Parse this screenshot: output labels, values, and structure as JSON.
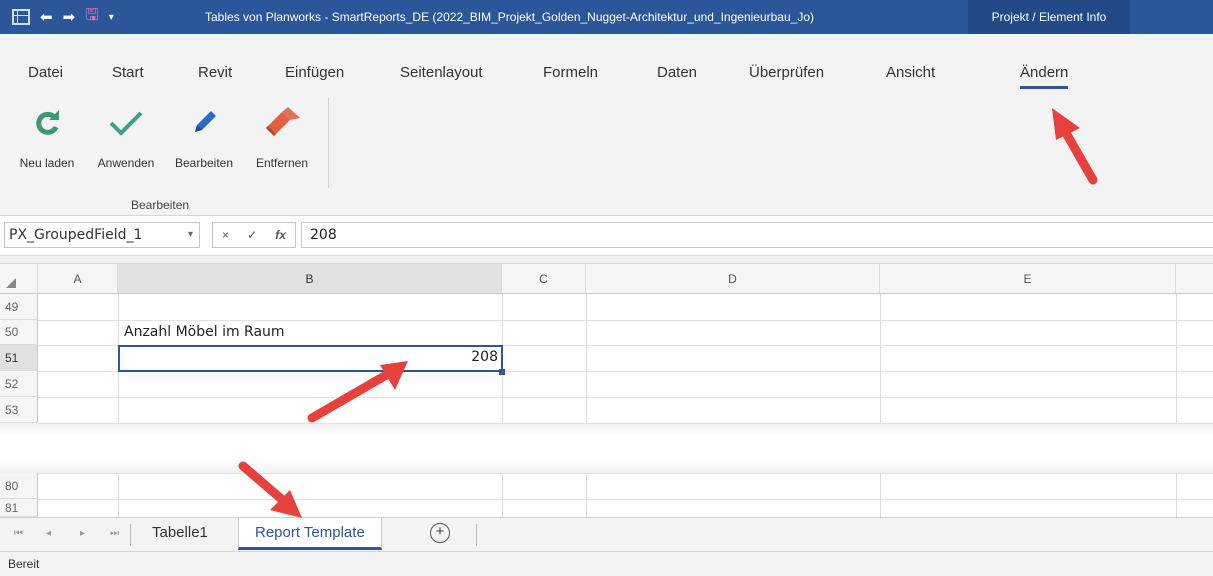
{
  "titlebar": {
    "title": "Tables von Planworks - SmartReports_DE  (2022_BIM_Projekt_Golden_Nugget-Architektur_und_Ingenieurbau_Jo)",
    "info_tab": "Projekt / Element Info",
    "accent": "#2b579a"
  },
  "menu": {
    "items": [
      "Datei",
      "Start",
      "Revit",
      "Einfügen",
      "Seitenlayout",
      "Formeln",
      "Daten",
      "Überprüfen",
      "Ansicht",
      "Ändern"
    ],
    "active": "Ändern"
  },
  "ribbon": {
    "buttons": [
      {
        "label": "Neu laden",
        "icon": "refresh-icon"
      },
      {
        "label": "Anwenden",
        "icon": "check-icon"
      },
      {
        "label": "Bearbeiten",
        "icon": "pencil-icon"
      },
      {
        "label": "Entfernen",
        "icon": "eraser-icon"
      }
    ],
    "group_label": "Bearbeiten"
  },
  "formula_bar": {
    "name_box": "PX_GroupedField_1",
    "cancel": "×",
    "confirm": "✓",
    "fx": "fx",
    "value": "208"
  },
  "grid": {
    "columns": [
      "A",
      "B",
      "C",
      "D",
      "E"
    ],
    "selected_column": "B",
    "rows_top": [
      "49",
      "50",
      "51",
      "52",
      "53"
    ],
    "rows_bottom": [
      "80",
      "81"
    ],
    "selected_row": "51",
    "cells": {
      "B50": "Anzahl Möbel im Raum",
      "B51": "208"
    }
  },
  "sheets": {
    "tabs": [
      "Tabelle1",
      "Report Template"
    ],
    "active": "Report Template",
    "add_label": "+"
  },
  "status": {
    "text": "Bereit"
  }
}
